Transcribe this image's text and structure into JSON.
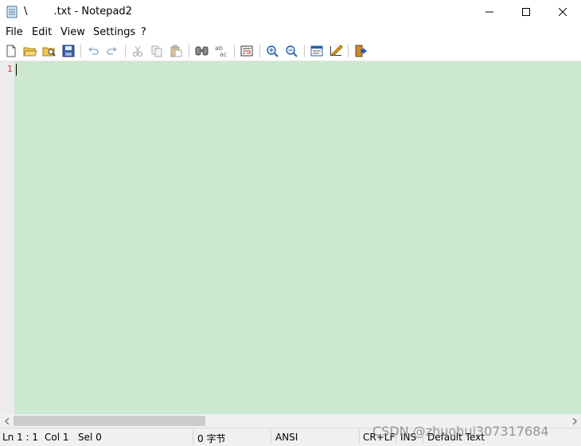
{
  "window": {
    "title": "\\        .txt - Notepad2"
  },
  "menu": [
    "File",
    "Edit",
    "View",
    "Settings",
    "?"
  ],
  "toolbar": {
    "buttons": [
      "new-file-icon",
      "open-folder-icon",
      "browse-icon",
      "save-icon",
      "undo-icon",
      "redo-icon",
      "cut-icon",
      "copy-icon",
      "paste-icon",
      "find-icon",
      "replace-icon",
      "word-wrap-icon",
      "zoom-in-icon",
      "zoom-out-icon",
      "select-scheme-icon",
      "customize-scheme-icon",
      "exit-icon"
    ]
  },
  "editor": {
    "line_number": "1",
    "background_color": "#cce8cf"
  },
  "statusbar": {
    "position": "Ln 1 : 1",
    "column": "Col 1",
    "selection": "Sel 0",
    "size": "0 字节",
    "encoding": "ANSI",
    "line_ending": "CR+LF",
    "insert_mode": "INS",
    "scheme": "Default Text"
  },
  "watermark": "CSDN @zhuohui307317684"
}
